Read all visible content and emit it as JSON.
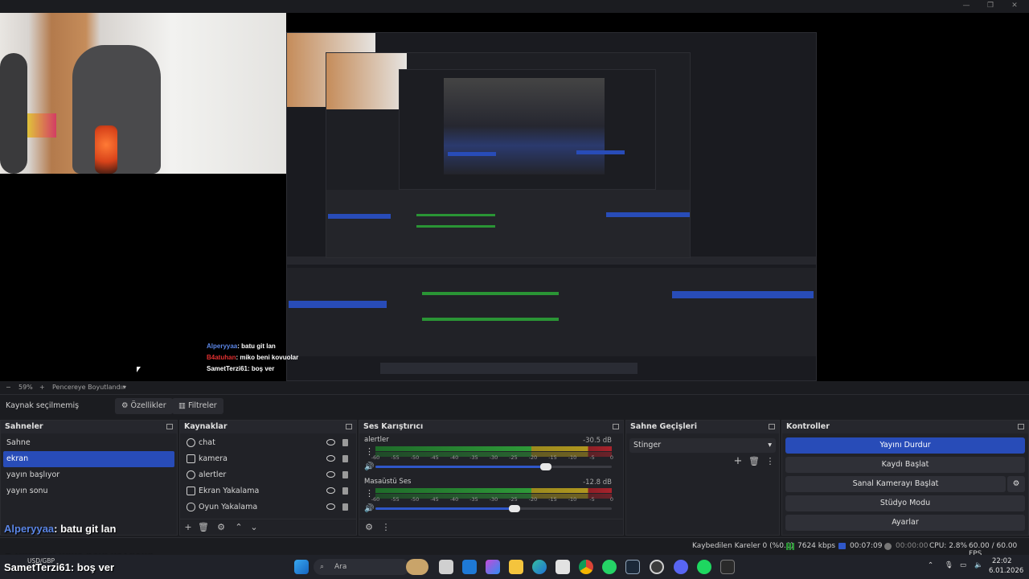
{
  "window": {
    "min_icon": "minimize-icon",
    "max_icon": "maximize-icon",
    "close_icon": "close-icon"
  },
  "preview": {
    "zoom": "59%",
    "zoom_minus": "−",
    "zoom_plus": "+",
    "fit_label": "Pencereye Boyutlandır"
  },
  "source_toolbar": {
    "no_source": "Kaynak seçilmemiş",
    "properties": "Özellikler",
    "filters": "Filtreler"
  },
  "scenes": {
    "title": "Sahneler",
    "items": [
      "Sahne",
      "ekran",
      "yayın başlıyor",
      "yayın sonu"
    ],
    "selected_index": 1
  },
  "sources": {
    "title": "Kaynaklar",
    "items": [
      {
        "name": "chat",
        "icon": "browser-icon"
      },
      {
        "name": "kamera",
        "icon": "camera-icon"
      },
      {
        "name": "alertler",
        "icon": "browser-icon"
      },
      {
        "name": "Ekran Yakalama",
        "icon": "monitor-icon"
      },
      {
        "name": "Oyun Yakalama",
        "icon": "gamepad-icon"
      }
    ]
  },
  "mixer": {
    "title": "Ses Karıştırıcı",
    "channels": [
      {
        "name": "alertler",
        "db": "-30.5 dB",
        "volume": 0.72
      },
      {
        "name": "Masaüstü Ses",
        "db": "-12.8 dB",
        "volume": 0.59
      }
    ],
    "ticks": [
      "-60",
      "-55",
      "-50",
      "-45",
      "-40",
      "-35",
      "-30",
      "-25",
      "-20",
      "-15",
      "-10",
      "-5",
      "0"
    ]
  },
  "transitions": {
    "title": "Sahne Geçişleri",
    "selected": "Stinger"
  },
  "controls": {
    "title": "Kontroller",
    "buttons": [
      "Yayını Durdur",
      "Kaydı Başlat",
      "Sanal Kamerayı Başlat",
      "Stüdyo Modu",
      "Ayarlar"
    ]
  },
  "chat": [
    {
      "user": "Alperyyaa",
      "msg": ": batu git lan"
    },
    {
      "user": "B4atuhan",
      "msg": ": miko beni kovuolar"
    },
    {
      "user": "SametTerzi61",
      "msg": ": boş ver"
    }
  ],
  "status": {
    "dropped": "Kaybedilen Kareler 0 (%0.0)",
    "bitrate": "7624 kbps",
    "stream_time": "00:07:09",
    "rec_time": "00:00:00",
    "cpu": "CPU: 2.8%",
    "fps": "60.00 / 60.00 FPS"
  },
  "taskbar": {
    "ticker": "USD/GBP",
    "search": "Ara",
    "time": "22:02",
    "date": "6.01.2026"
  },
  "colors": {
    "accent": "#284cb8",
    "bg": "#1b1c20",
    "panel": "#212227"
  }
}
